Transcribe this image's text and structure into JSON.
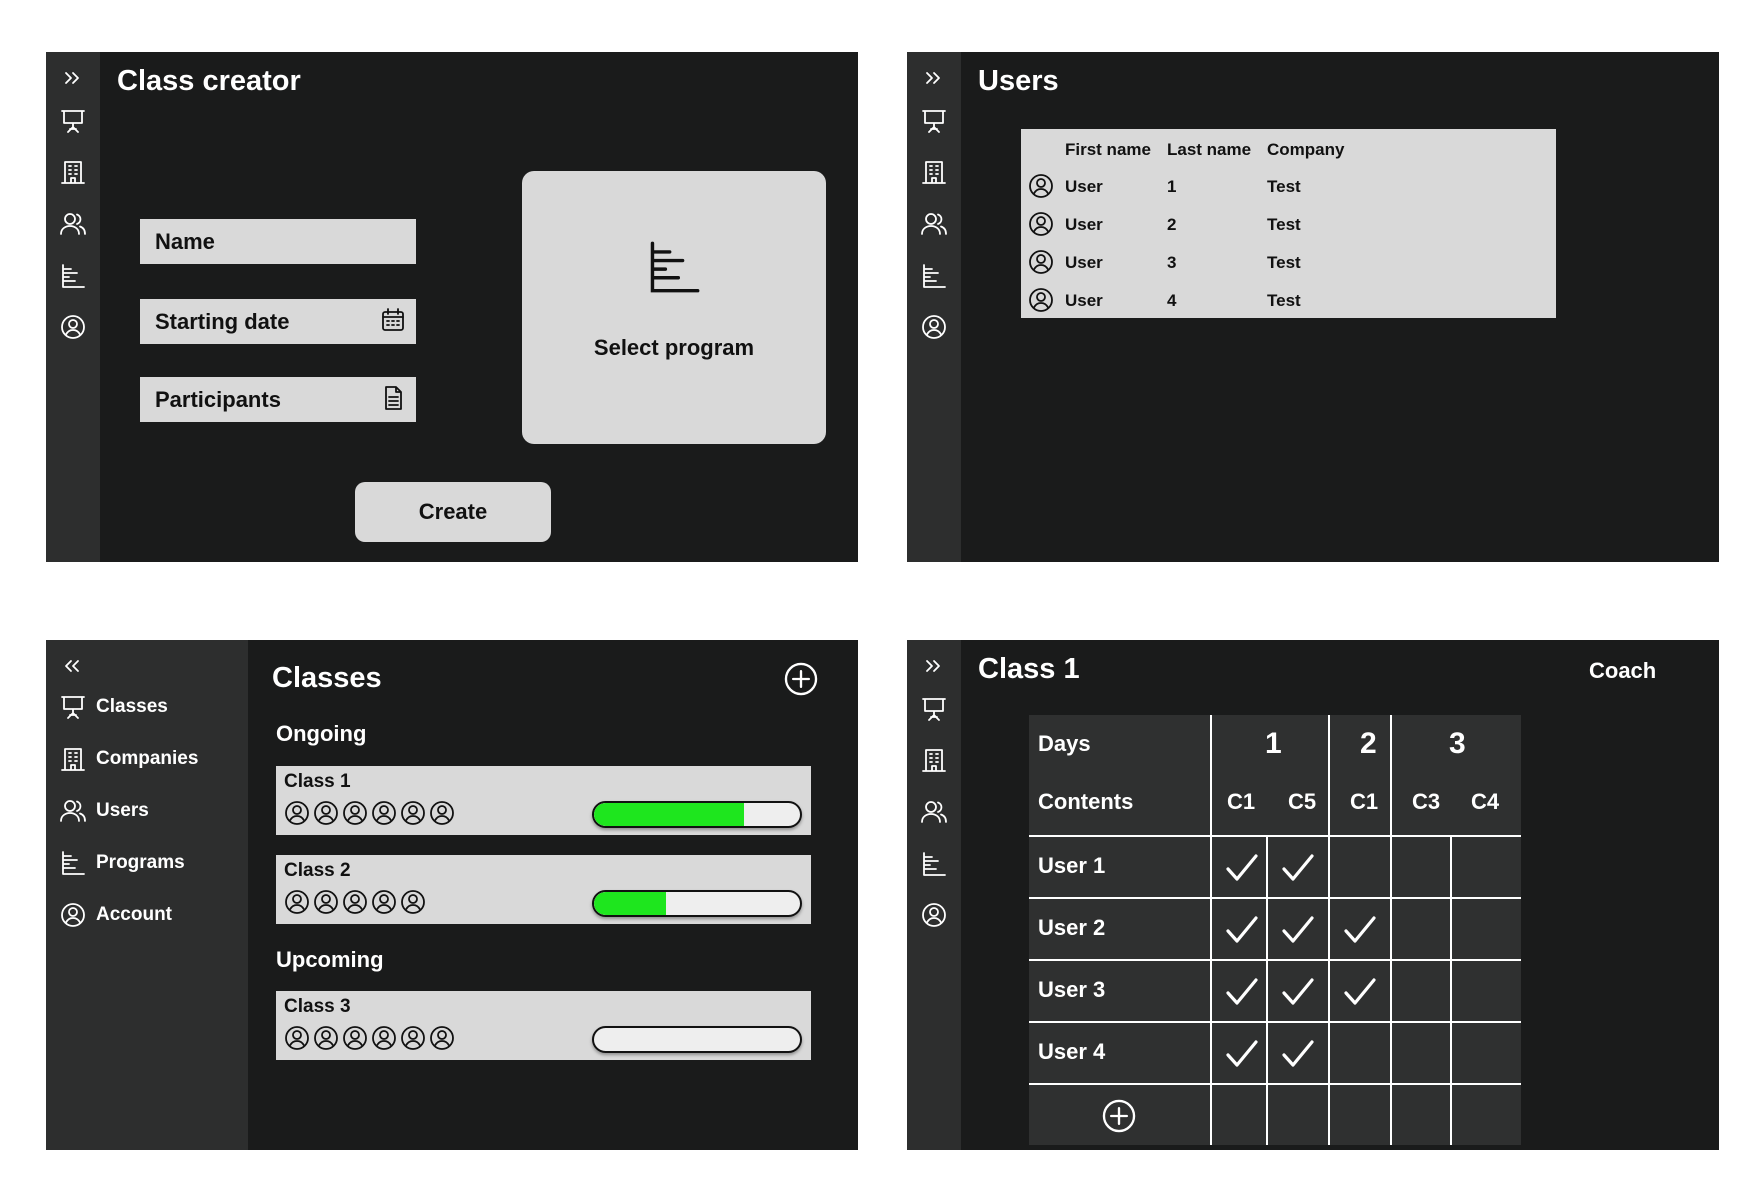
{
  "panel1": {
    "title": "Class creator",
    "fields": [
      {
        "label": "Name",
        "icon": ""
      },
      {
        "label": "Starting date",
        "icon": "calendar-icon"
      },
      {
        "label": "Participants",
        "icon": "document-icon"
      }
    ],
    "program_card_label": "Select program",
    "create_label": "Create"
  },
  "panel2": {
    "title": "Users",
    "columns": [
      "First name",
      "Last name",
      "Company"
    ],
    "rows": [
      {
        "first": "User",
        "last": "1",
        "company": "Test"
      },
      {
        "first": "User",
        "last": "2",
        "company": "Test"
      },
      {
        "first": "User",
        "last": "3",
        "company": "Test"
      },
      {
        "first": "User",
        "last": "4",
        "company": "Test"
      }
    ]
  },
  "panel3": {
    "title": "Classes",
    "nav": [
      {
        "label": "Classes",
        "icon": "presentation-icon"
      },
      {
        "label": "Companies",
        "icon": "building-icon"
      },
      {
        "label": "Users",
        "icon": "users-icon"
      },
      {
        "label": "Programs",
        "icon": "program-icon"
      },
      {
        "label": "Account",
        "icon": "account-icon"
      }
    ],
    "ongoing_label": "Ongoing",
    "upcoming_label": "Upcoming",
    "classes": [
      {
        "name": "Class 1",
        "participants": 6,
        "progress": 0.73
      },
      {
        "name": "Class 2",
        "participants": 5,
        "progress": 0.35
      },
      {
        "name": "Class 3",
        "participants": 6,
        "progress": 0.0
      }
    ]
  },
  "panel4": {
    "title": "Class 1",
    "coach_label": "Coach",
    "days_label": "Days",
    "contents_label": "Contents",
    "days": [
      "1",
      "2",
      "3"
    ],
    "contents": [
      "C1",
      "C5",
      "C1",
      "C3",
      "C4"
    ],
    "users": [
      {
        "name": "User 1",
        "checks": [
          true,
          true,
          false,
          false,
          false
        ]
      },
      {
        "name": "User 2",
        "checks": [
          true,
          true,
          true,
          false,
          false
        ]
      },
      {
        "name": "User 3",
        "checks": [
          true,
          true,
          true,
          false,
          false
        ]
      },
      {
        "name": "User 4",
        "checks": [
          true,
          true,
          false,
          false,
          false
        ]
      }
    ]
  },
  "colors": {
    "panel_bg": "#1a1b1b",
    "rail_bg": "#2d2e2e",
    "card_bg": "#d9d9d9",
    "progress_fill": "#1ee61e"
  }
}
